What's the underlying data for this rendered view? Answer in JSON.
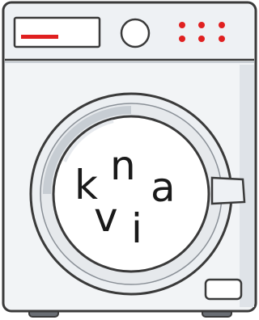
{
  "drum": {
    "letters": {
      "k": "k",
      "n": "n",
      "a": "a",
      "v": "v",
      "i": "i"
    }
  },
  "colors": {
    "outline": "#3a3a3a",
    "body": "#f2f4f6",
    "panel_shadow": "#d3d8de",
    "door_ring": "#e9ecef",
    "door_glass": "#ffffff",
    "indicator_light": "#e02020",
    "feet": "#6a6e74"
  },
  "icons": {
    "control_panel": "display-window-icon",
    "dial": "program-dial-icon",
    "lights": "indicator-lights-icon",
    "detergent": "detergent-drawer-icon",
    "door_latch": "door-handle-icon"
  },
  "control_panel": {
    "indicator_lights_count": 6
  }
}
